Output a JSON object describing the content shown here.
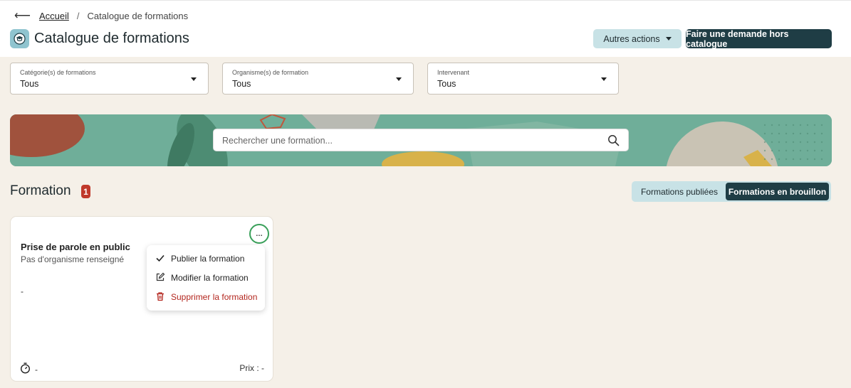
{
  "breadcrumb": {
    "home": "Accueil",
    "separator": "/",
    "current": "Catalogue de formations"
  },
  "header": {
    "title": "Catalogue de formations",
    "other_actions_label": "Autres actions",
    "request_label": "Faire une demande hors catalogue"
  },
  "filters": [
    {
      "label": "Catégorie(s) de formations",
      "value": "Tous"
    },
    {
      "label": "Organisme(s) de formation",
      "value": "Tous"
    },
    {
      "label": "Intervenant",
      "value": "Tous"
    }
  ],
  "search": {
    "placeholder": "Rechercher une formation..."
  },
  "section": {
    "title": "Formation",
    "count": "1",
    "tabs": [
      "Formations publiées",
      "Formations en brouillon"
    ],
    "active_tab": "Formations en brouillon"
  },
  "card": {
    "name": "Prise de parole en public",
    "organism": "Pas d'organisme renseigné",
    "description": "-",
    "duration": "-",
    "price": "Prix : -",
    "more_label": "…"
  },
  "menu": {
    "publish": "Publier la formation",
    "edit": "Modifier la formation",
    "delete": "Supprimer la formation"
  },
  "colors": {
    "primary": "#1f3d45",
    "secondary": "#c8e2e6",
    "danger": "#c0392b",
    "focus_ring": "#3aa05a"
  }
}
